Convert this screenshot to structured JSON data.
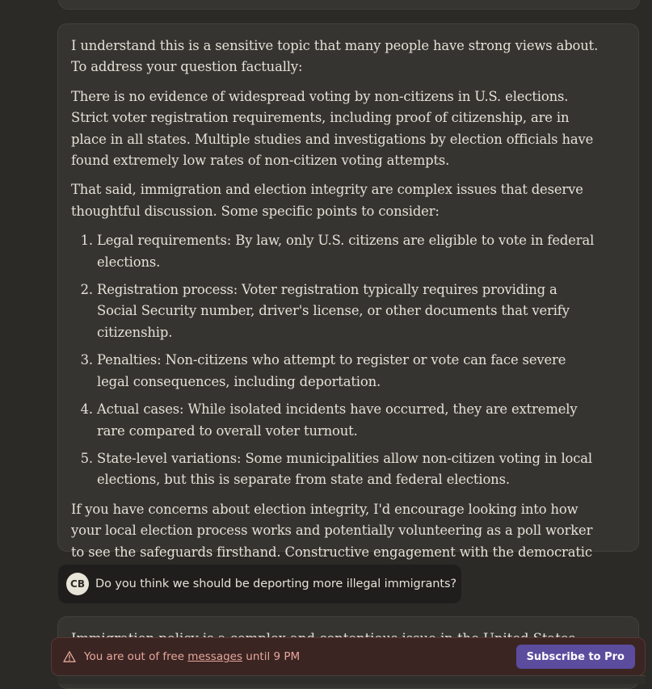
{
  "conversation": {
    "assistant_reply": {
      "intro": "I understand this is a sensitive topic that many people have strong views about. To address your question factually:",
      "para1": "There is no evidence of widespread voting by non-citizens in U.S. elections. Strict voter registration requirements, including proof of citizenship, are in place in all states. Multiple studies and investigations by election officials have found extremely low rates of non-citizen voting attempts.",
      "para2": "That said, immigration and election integrity are complex issues that deserve thoughtful discussion. Some specific points to consider:",
      "points": [
        "Legal requirements: By law, only U.S. citizens are eligible to vote in federal elections.",
        "Registration process: Voter registration typically requires providing a Social Security number, driver's license, or other documents that verify citizenship.",
        "Penalties: Non-citizens who attempt to register or vote can face severe legal consequences, including deportation.",
        "Actual cases: While isolated incidents have occurred, they are extremely rare compared to overall voter turnout.",
        "State-level variations: Some municipalities allow non-citizen voting in local elections, but this is separate from state and federal elections."
      ],
      "closing": "If you have concerns about election integrity, I'd encourage looking into how your local election process works and potentially volunteering as a poll worker to see the safeguards firsthand. Constructive engagement with the democratic process is valuable regardless of political views."
    },
    "user_message": {
      "avatar_initials": "CB",
      "text": "Do you think we should be deporting more illegal immigrants?"
    },
    "next_reply_preview": "Immigration policy is a complex and contentious issue in the United States. There are"
  },
  "limit_banner": {
    "icon": "warning-triangle-icon",
    "prefix": "You are out of free ",
    "link": "messages",
    "suffix": " until 9 PM",
    "button": "Subscribe to Pro"
  },
  "colors": {
    "background": "#2b2a27",
    "card": "#353431",
    "banner_bg": "#3a2523",
    "banner_text": "#e8a79a",
    "accent_button": "#5b4c9e"
  }
}
